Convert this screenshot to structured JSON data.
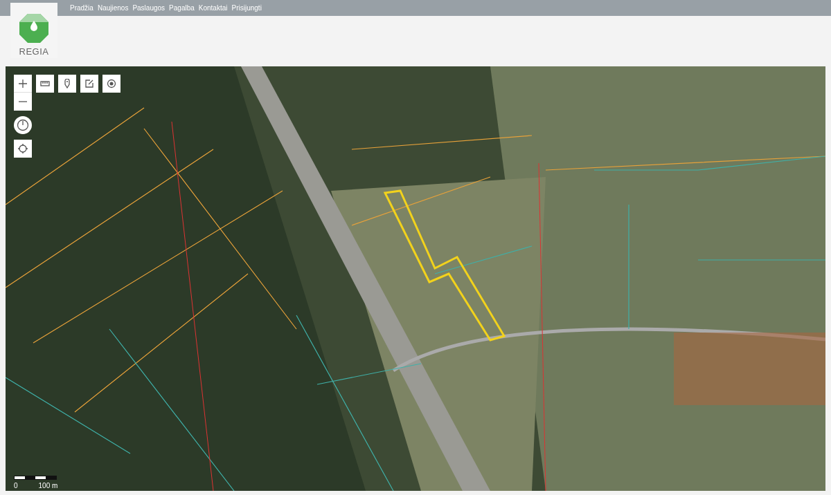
{
  "header": {
    "logo_text": "REGIA",
    "nav": [
      {
        "label": "Pradžia"
      },
      {
        "label": "Naujienos"
      },
      {
        "label": "Paslaugos"
      },
      {
        "label": "Pagalba"
      },
      {
        "label": "Kontaktai"
      },
      {
        "label": "Prisijungti"
      }
    ]
  },
  "map": {
    "tools": [
      {
        "kind": "measure"
      },
      {
        "kind": "pin"
      },
      {
        "kind": "edit"
      },
      {
        "kind": "target"
      }
    ],
    "scale": {
      "start": "0",
      "end": "100 m"
    }
  }
}
